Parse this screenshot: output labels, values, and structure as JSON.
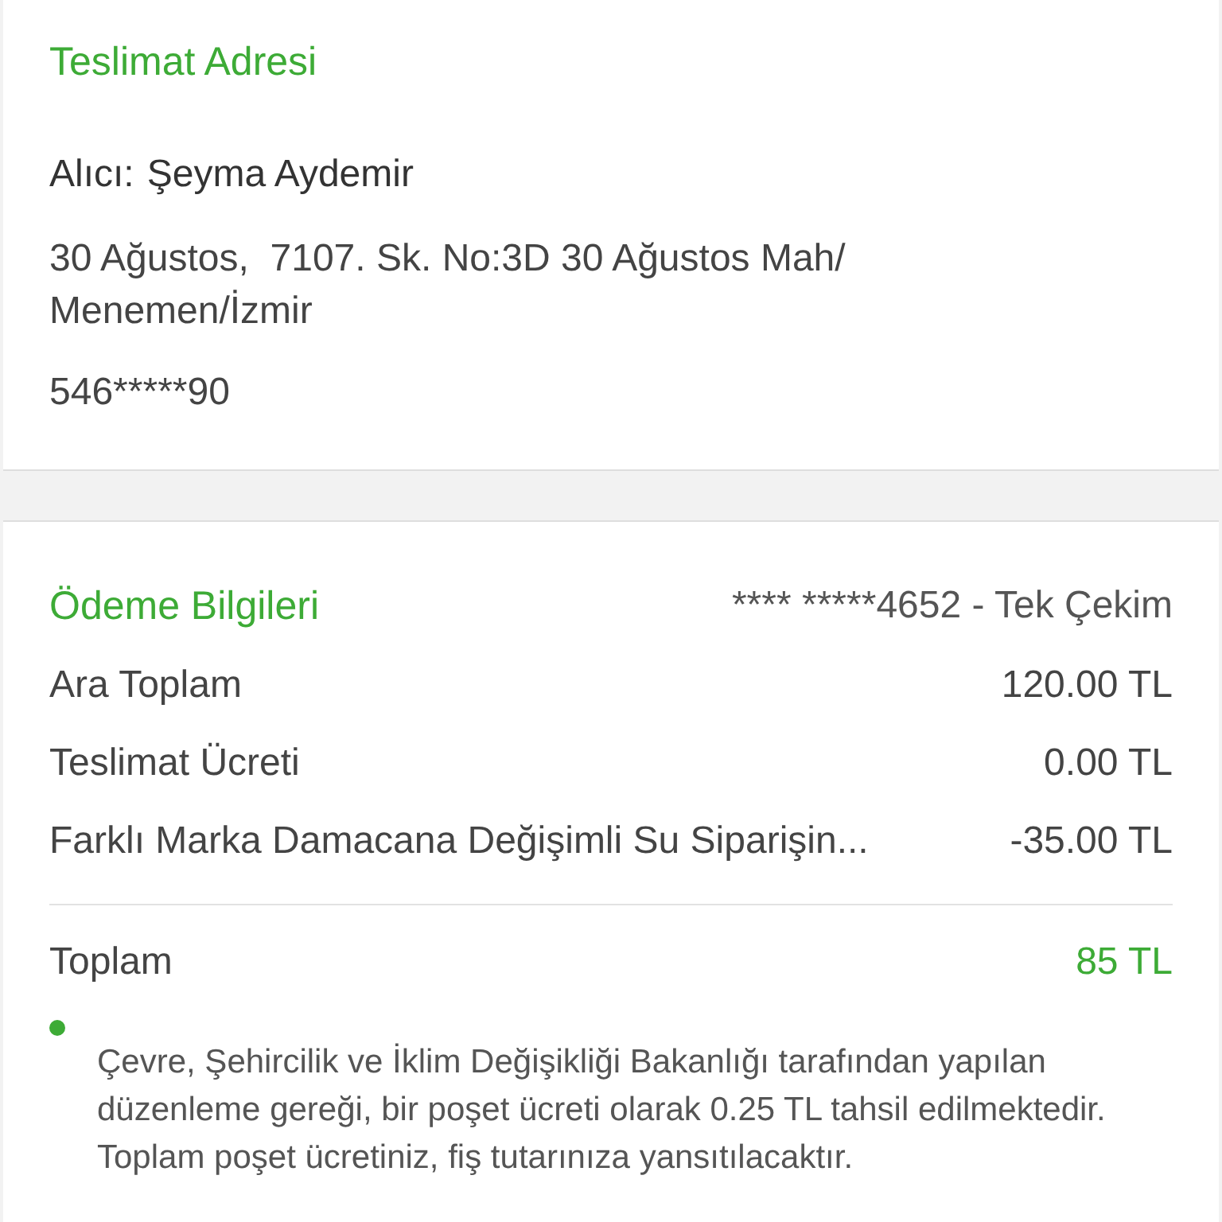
{
  "delivery": {
    "title": "Teslimat Adresi",
    "recipient_label": "Alıcı:",
    "recipient": "Şeyma Aydemir",
    "address": "30 Ağustos,  7107. Sk. No:3D 30 Ağustos Mah/ Menemen/İzmir",
    "phone": "546*****90"
  },
  "payment": {
    "title": "Ödeme Bilgileri",
    "card": "**** *****4652 - Tek Çekim",
    "lines": [
      {
        "label": "Ara Toplam",
        "amount": "120.00 TL"
      },
      {
        "label": "Teslimat Ücreti",
        "amount": "0.00 TL"
      },
      {
        "label": "Farklı Marka Damacana Değişimli Su Siparişin...",
        "amount": "-35.00 TL"
      }
    ],
    "total": {
      "label": "Toplam",
      "amount": "85 TL"
    },
    "notes": [
      "Çevre, Şehircilik ve İklim Değişikliği Bakanlığı tarafından yapılan düzenleme gereği, bir poşet ücreti olarak 0.25 TL tahsil edilmektedir. Toplam poşet ücretiniz, fiş tutarınıza yansıtılacaktır."
    ]
  }
}
